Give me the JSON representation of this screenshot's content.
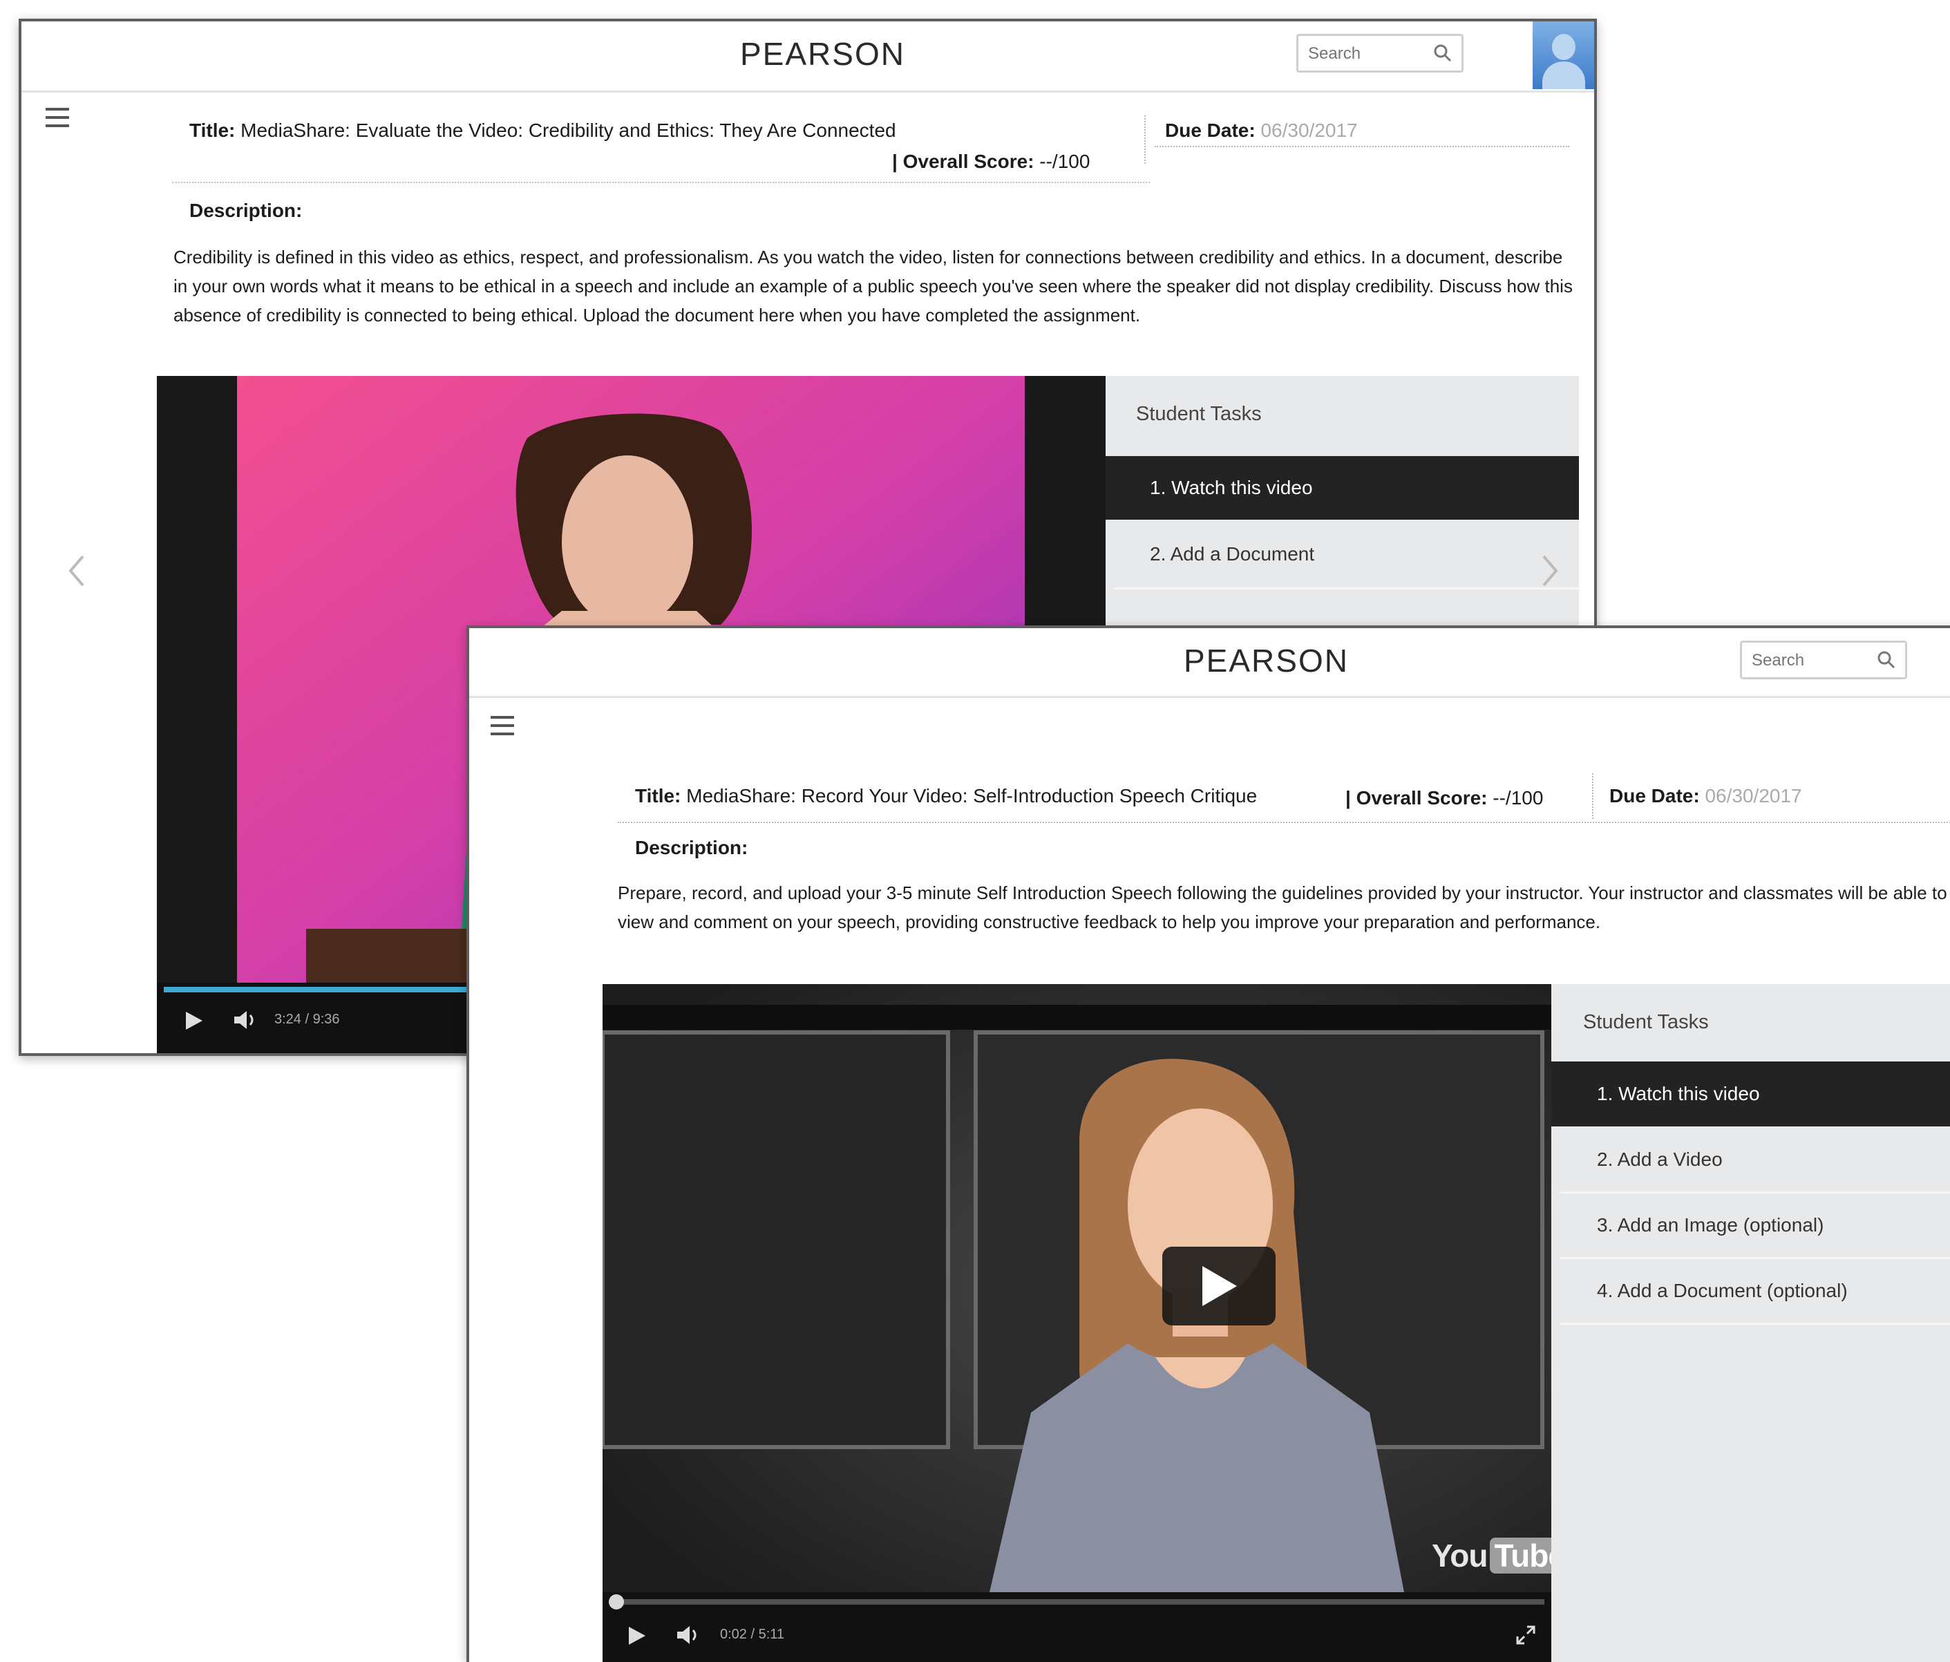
{
  "window1": {
    "brand": "PEARSON",
    "search_placeholder": "Search",
    "title_label": "Title:",
    "title_value": "MediaShare: Evaluate the Video: Credibility and Ethics: They Are Connected",
    "due_label": "Due Date:",
    "due_value": "06/30/2017",
    "score_label": "| Overall Score:",
    "score_value": "--/100",
    "description_label": "Description:",
    "description": "Credibility is defined in this video as ethics, respect, and professionalism. As you watch the video, listen for connections between credibility and ethics. In a document, describe in your own words what it means to be ethical in a speech and include an example of a public speech you've seen where the speaker did not display credibility. Discuss how this absence of credibility is connected to being ethical. Upload the document here when you have completed the assignment.",
    "tasks_header": "Student Tasks",
    "tasks": [
      "1. Watch this video",
      "2. Add a Document"
    ],
    "video_time": "3:24 / 9:36",
    "video_progress": 0.35
  },
  "window2": {
    "brand": "PEARSON",
    "search_placeholder": "Search",
    "title_label": "Title:",
    "title_value": "MediaShare: Record Your Video: Self-Introduction Speech Critique",
    "score_label": "| Overall Score:",
    "score_value": "--/100",
    "due_label": "Due Date:",
    "due_value": "06/30/2017",
    "description_label": "Description:",
    "description": "Prepare, record, and upload your 3-5 minute Self Introduction Speech following the guidelines provided by your instructor. Your instructor and classmates will be able to view and comment on your speech, providing constructive feedback to help you improve your preparation and performance.",
    "tasks_header": "Student Tasks",
    "tasks": [
      "1. Watch this video",
      "2. Add a Video",
      "3. Add an Image (optional)",
      "4. Add a Document (optional)"
    ],
    "video_time": "0:02 / 5:11",
    "video_progress": 0.01,
    "youtube_logo": {
      "you": "You",
      "tube": "Tube"
    }
  }
}
